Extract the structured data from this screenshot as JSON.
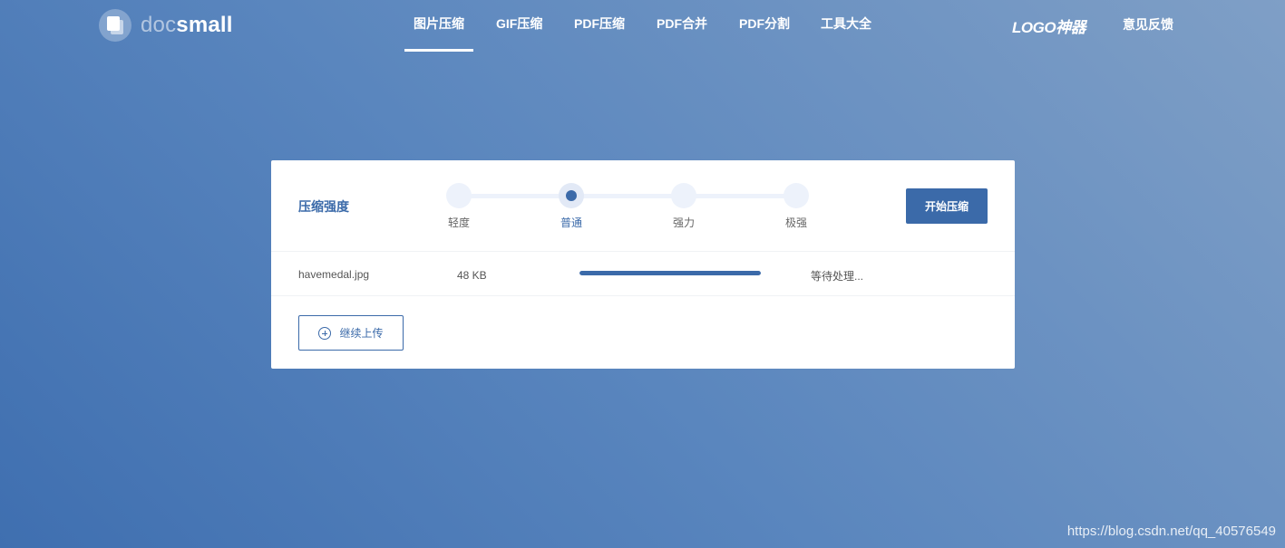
{
  "header": {
    "logo_doc": "doc",
    "logo_small": "small",
    "nav": [
      {
        "label": "图片压缩",
        "active": true
      },
      {
        "label": "GIF压缩",
        "active": false
      },
      {
        "label": "PDF压缩",
        "active": false
      },
      {
        "label": "PDF合并",
        "active": false
      },
      {
        "label": "PDF分割",
        "active": false
      },
      {
        "label": "工具大全",
        "active": false
      }
    ],
    "logo_tool": "LOGO神器",
    "feedback": "意见反馈"
  },
  "compress": {
    "strength_label": "压缩强度",
    "levels": [
      "轻度",
      "普通",
      "强力",
      "极强"
    ],
    "selected_level": "普通",
    "start_button": "开始压缩"
  },
  "file": {
    "name": "havemedal.jpg",
    "size": "48 KB",
    "progress_fraction": 1.0,
    "status": "等待处理..."
  },
  "upload": {
    "icon": "plus-circle-icon",
    "label": "继续上传"
  },
  "watermark": "https://blog.csdn.net/qq_40576549",
  "colors": {
    "accent": "#3b6aa9",
    "track": "#edf2fb"
  }
}
